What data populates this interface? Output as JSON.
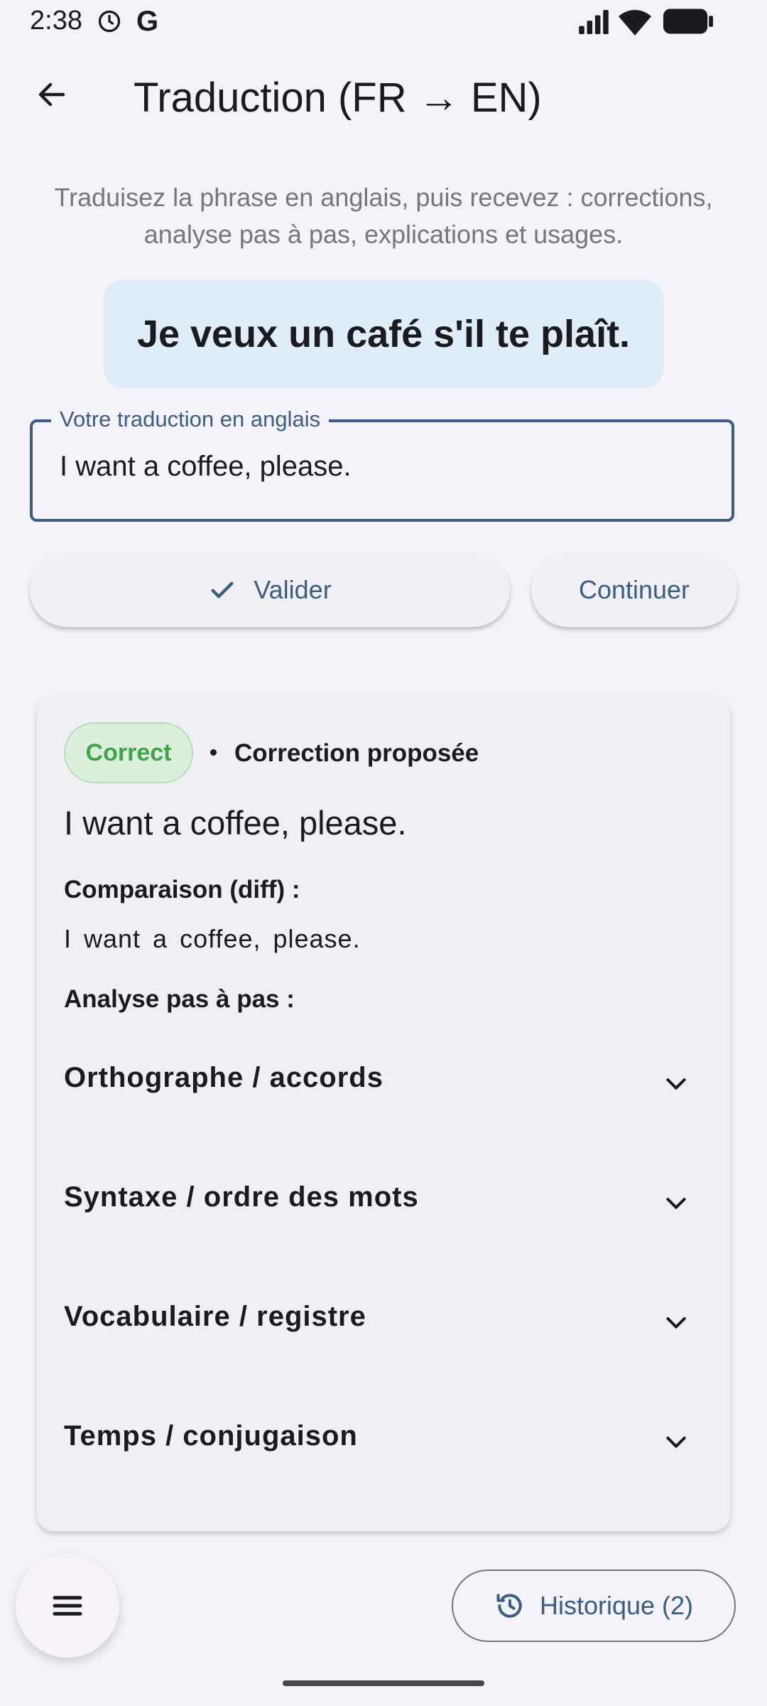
{
  "status_bar": {
    "time": "2:38",
    "g_label": "G"
  },
  "header": {
    "title": "Traduction (FR → EN)"
  },
  "instructions": "Traduisez la phrase en anglais, puis recevez : corrections, analyse pas à pas, explications et usages.",
  "source_sentence": "Je veux un café s'il te plaît.",
  "translation_field": {
    "label": "Votre traduction en anglais",
    "value": "I want a coffee, please."
  },
  "actions": {
    "validate_label": "Valider",
    "continue_label": "Continuer"
  },
  "result": {
    "status_badge": "Correct",
    "correction_label": "Correction proposée",
    "proposed_text": "I want a coffee, please.",
    "diff_label": "Comparaison (diff) :",
    "diff_text": "I want a coffee, please.",
    "analysis_label": "Analyse pas à pas :",
    "sections": [
      {
        "label": "Orthographe / accords"
      },
      {
        "label": "Syntaxe / ordre des mots"
      },
      {
        "label": "Vocabulaire / registre"
      },
      {
        "label": "Temps / conjugaison"
      }
    ]
  },
  "history_button": {
    "label": "Historique (2)"
  },
  "colors": {
    "accent": "#3a5c87",
    "correct": "#3fa549",
    "source_bg": "#dfedf9",
    "background": "#f4f3f9"
  },
  "icons": [
    "alarm-icon",
    "signal-icon",
    "wifi-icon",
    "battery-icon",
    "back-arrow-icon",
    "check-icon",
    "chevron-down-icon",
    "menu-icon",
    "history-icon"
  ]
}
